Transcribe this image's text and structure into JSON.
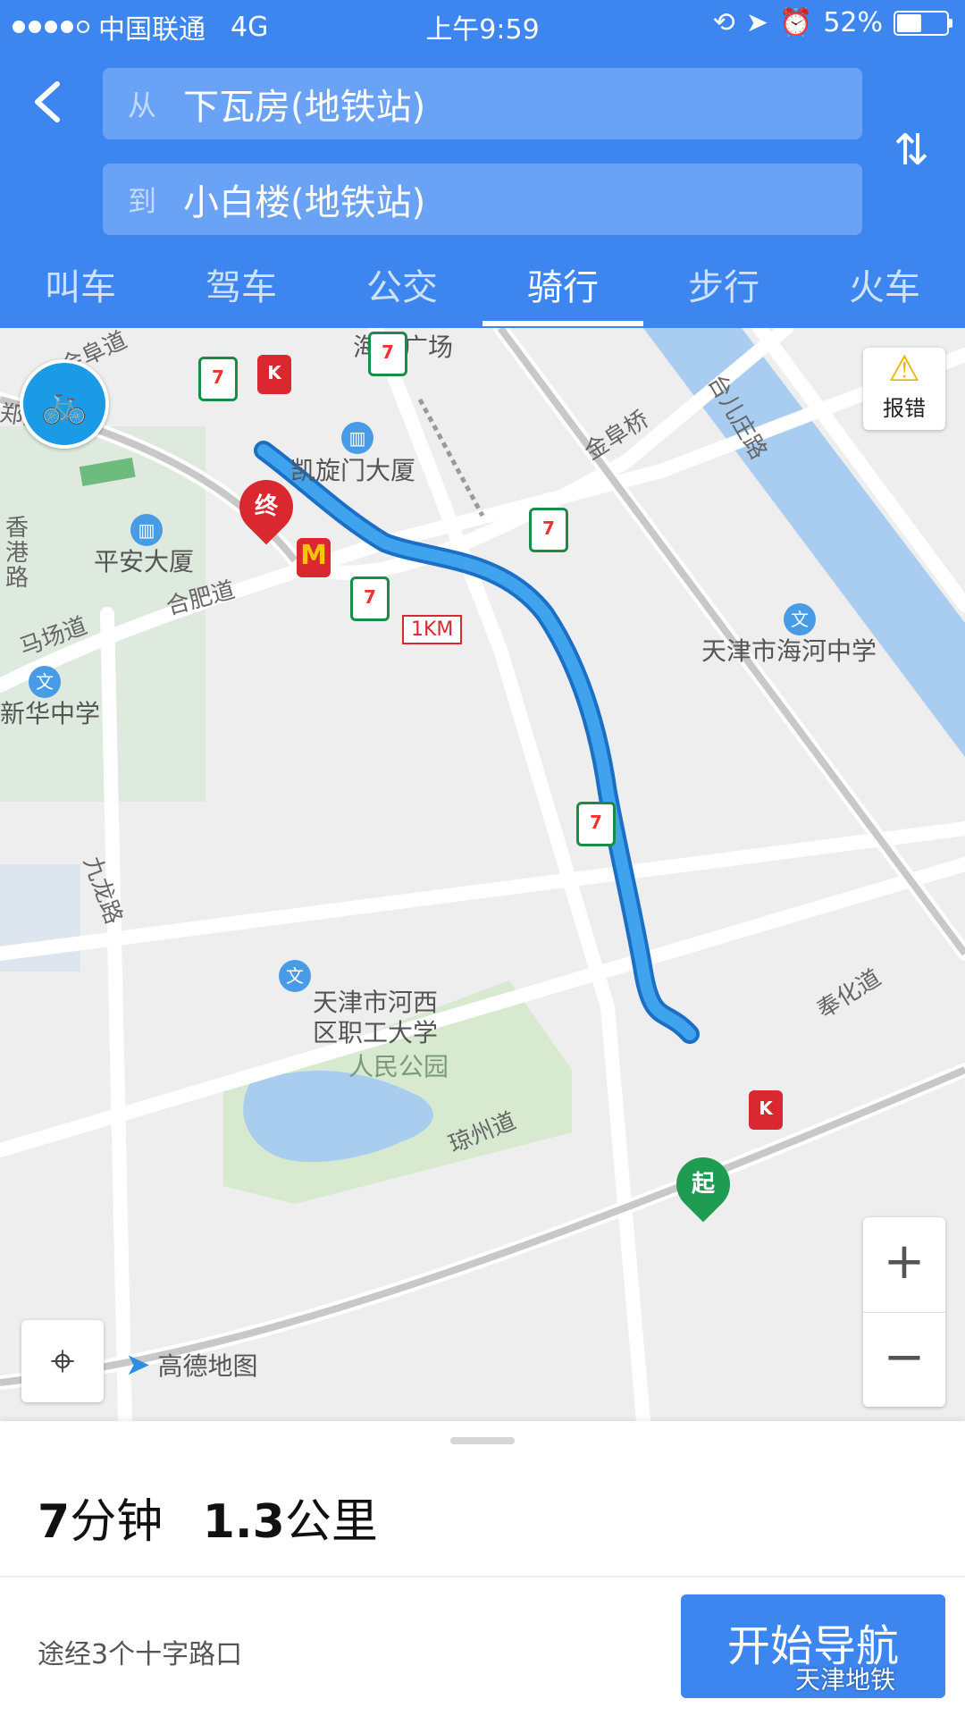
{
  "status_bar": {
    "carrier": "中国联通",
    "network": "4G",
    "time": "上午9:59",
    "battery": "52%",
    "battery_level": 0.52
  },
  "header": {
    "from_tag": "从",
    "from_value": "下瓦房(地铁站)",
    "to_tag": "到",
    "to_value": "小白楼(地铁站)"
  },
  "tabs": [
    {
      "label": "叫车"
    },
    {
      "label": "驾车"
    },
    {
      "label": "公交"
    },
    {
      "label": "骑行"
    },
    {
      "label": "步行"
    },
    {
      "label": "火车"
    }
  ],
  "active_tab": "骑行",
  "map": {
    "labels": {
      "haixin": "海信广场",
      "kaixuanmen": "凯旋门大厦",
      "pingan": "平安大厦",
      "haihe_school": "天津市海河中学",
      "xinhua_school": "新华中学",
      "hexi_school_line1": "天津市河西",
      "hexi_school_line2": "区职工大学",
      "renmin_park": "人民公园"
    },
    "roads": {
      "jinfu_road": "金阜道",
      "zhengzhou_road": "郑州道",
      "xianggang_road": "香港路",
      "hefei_road": "合肥道",
      "machang_road": "马场道",
      "jiulong_road": "九龙路",
      "jinfu_bridge": "金阜桥",
      "taierzhuang_road": "台儿庄路",
      "fenghua_road": "奉化道",
      "qiongzhou_road": "琼州道"
    },
    "distance_marker": "1KM",
    "end_marker": "终",
    "start_marker": "起",
    "report_label": "报错",
    "logo_text": "高德地图"
  },
  "panel": {
    "duration_value": "7",
    "duration_unit": "分钟",
    "distance_value": "1.3",
    "distance_unit": "公里",
    "via": "途经3个十字路口",
    "nav_button": "开始导航",
    "watermark": "天津地铁"
  },
  "colors": {
    "brand_blue": "#3d86f0",
    "route_blue": "#2b96e8",
    "end_red": "#d9282f",
    "start_green": "#1e9c51"
  }
}
